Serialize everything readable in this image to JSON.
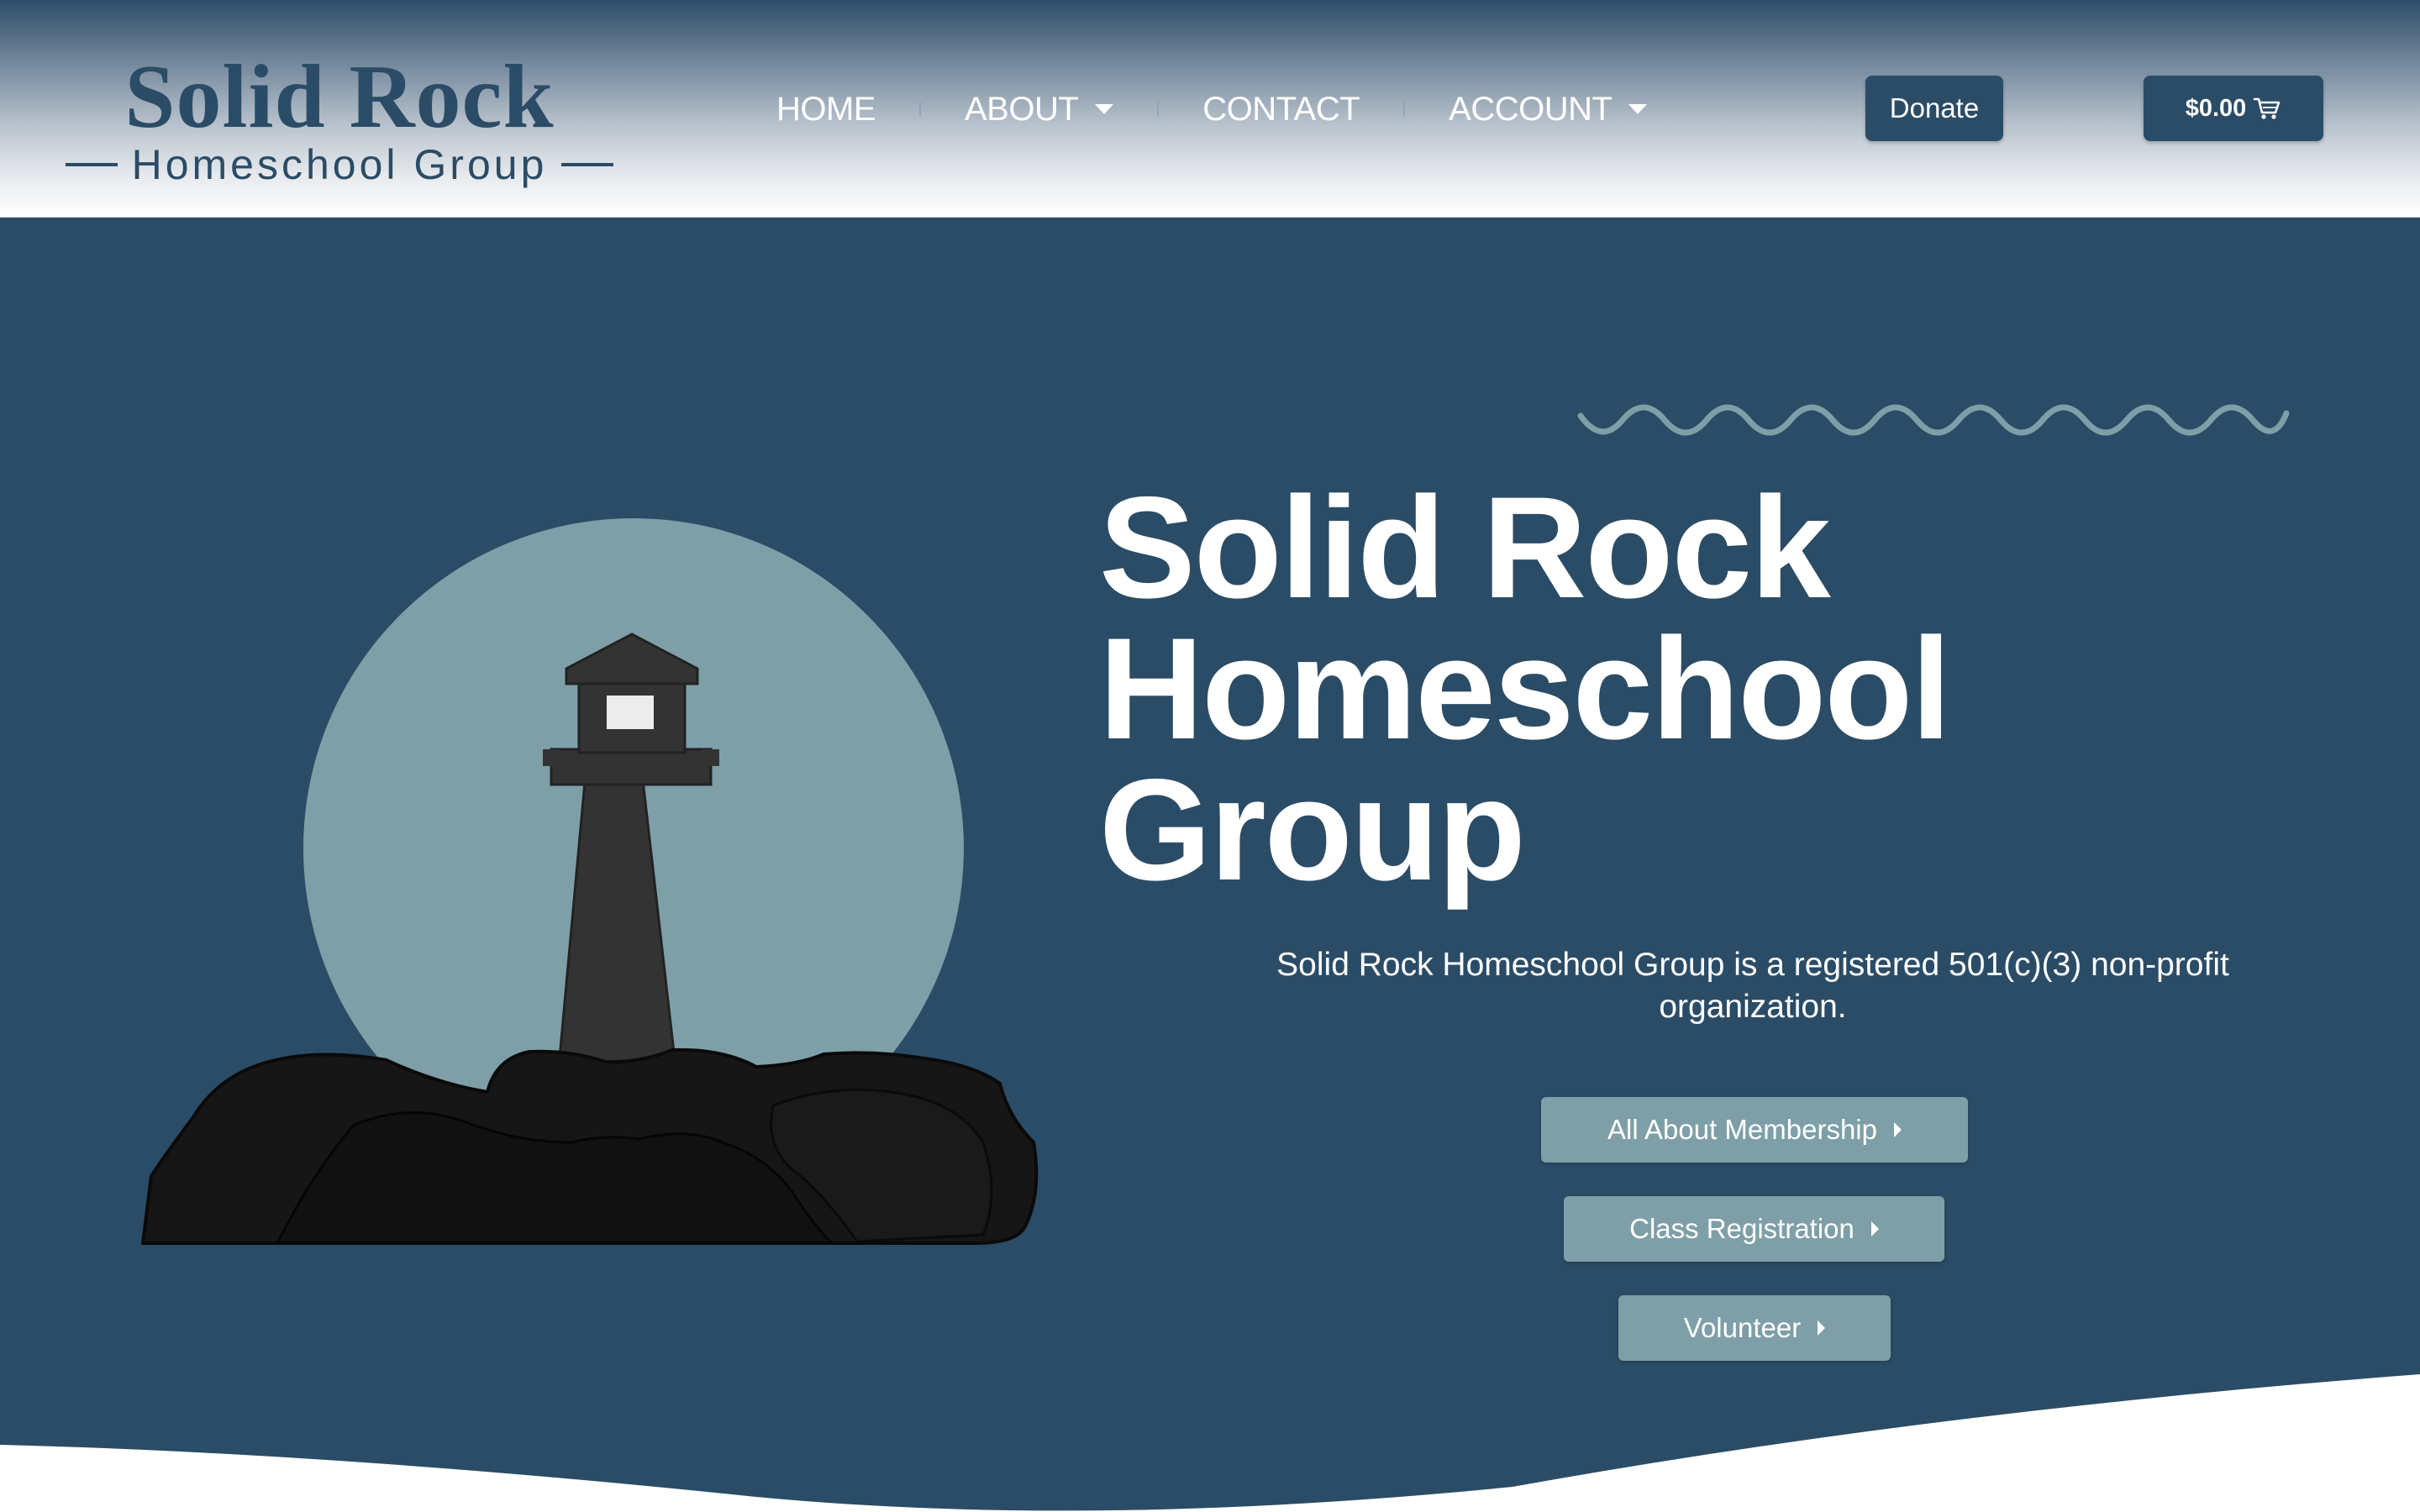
{
  "header": {
    "logo": {
      "main": "Solid Rock",
      "sub": "Homeschool Group"
    },
    "nav": [
      {
        "label": "HOME",
        "dropdown": false
      },
      {
        "label": "ABOUT",
        "dropdown": true
      },
      {
        "label": "CONTACT",
        "dropdown": false
      },
      {
        "label": "ACCOUNT",
        "dropdown": true
      }
    ],
    "donate_label": "Donate",
    "cart_label": "$0.00",
    "cart_icon": "cart-icon"
  },
  "hero": {
    "title_lines": [
      "Solid Rock",
      "Homeschool",
      "Group"
    ],
    "subtitle": "Solid Rock Homeschool Group is a registered 501(c)(3) non-profit organization.",
    "buttons": [
      {
        "label": "All About Membership",
        "icon": "caret-right-icon"
      },
      {
        "label": "Class Registration",
        "icon": "caret-right-icon"
      },
      {
        "label": "Volunteer",
        "icon": "caret-right-icon"
      }
    ]
  },
  "colors": {
    "primary": "#2b4c66",
    "accent": "#7e9fa7",
    "moon": "#7e9fa7",
    "lighthouse": "#333333",
    "rocks": "#141414",
    "white": "#ffffff"
  }
}
